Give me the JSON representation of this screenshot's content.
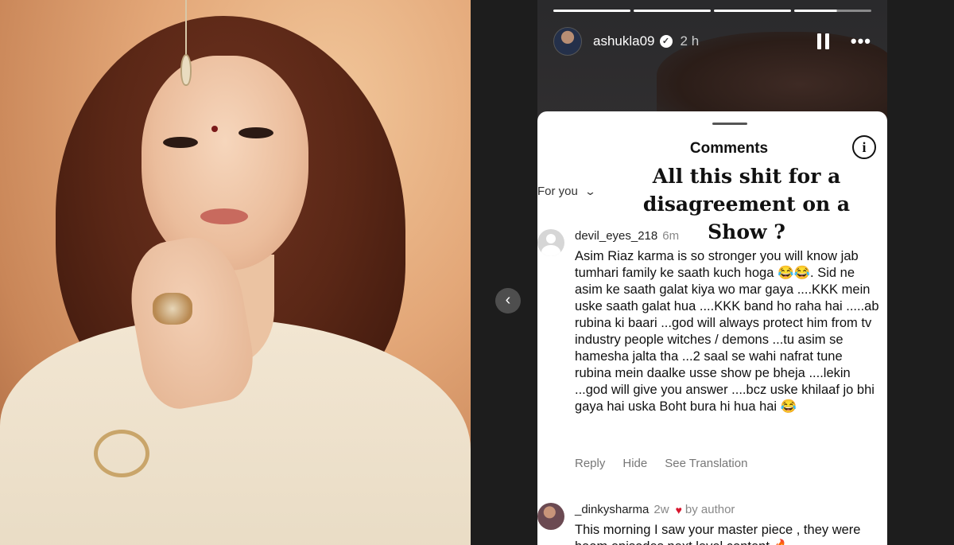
{
  "story": {
    "progress_segments": [
      1,
      1,
      1,
      0.55
    ],
    "username": "ashukla09",
    "verified_badge": "verified-icon",
    "time_ago": "2 h",
    "icons": {
      "pause": "pause-icon",
      "more": "more-icon",
      "prev": "chevron-left-icon"
    }
  },
  "sheet": {
    "title": "Comments",
    "filter_label": "For you",
    "overlay_caption": "All this shit for a disagreement on a Show ?"
  },
  "comments": [
    {
      "username": "devil_eyes_218",
      "time_ago": "6m",
      "text": "Asim Riaz karma is so stronger you will know jab tumhari family ke saath kuch hoga 😂😂. Sid ne asim ke saath galat kiya wo mar gaya ....KKK mein uske saath galat hua ....KKK band ho raha hai .....ab rubina ki baari ...god will always protect him from tv industry people witches / demons ...tu asim se hamesha jalta tha ...2 saal se wahi nafrat tune rubina mein daalke usse show pe bheja ....lekin ...god will give you answer ....bcz uske khilaaf jo bhi gaya hai uska Boht bura hi hua hai 😂",
      "actions": [
        "Reply",
        "Hide",
        "See Translation"
      ]
    },
    {
      "username": "_dinkysharma",
      "time_ago": "2w",
      "liked_by": "by author",
      "text": "This morning I saw your master piece , they were  haam episodes  next level content 🔥"
    }
  ]
}
